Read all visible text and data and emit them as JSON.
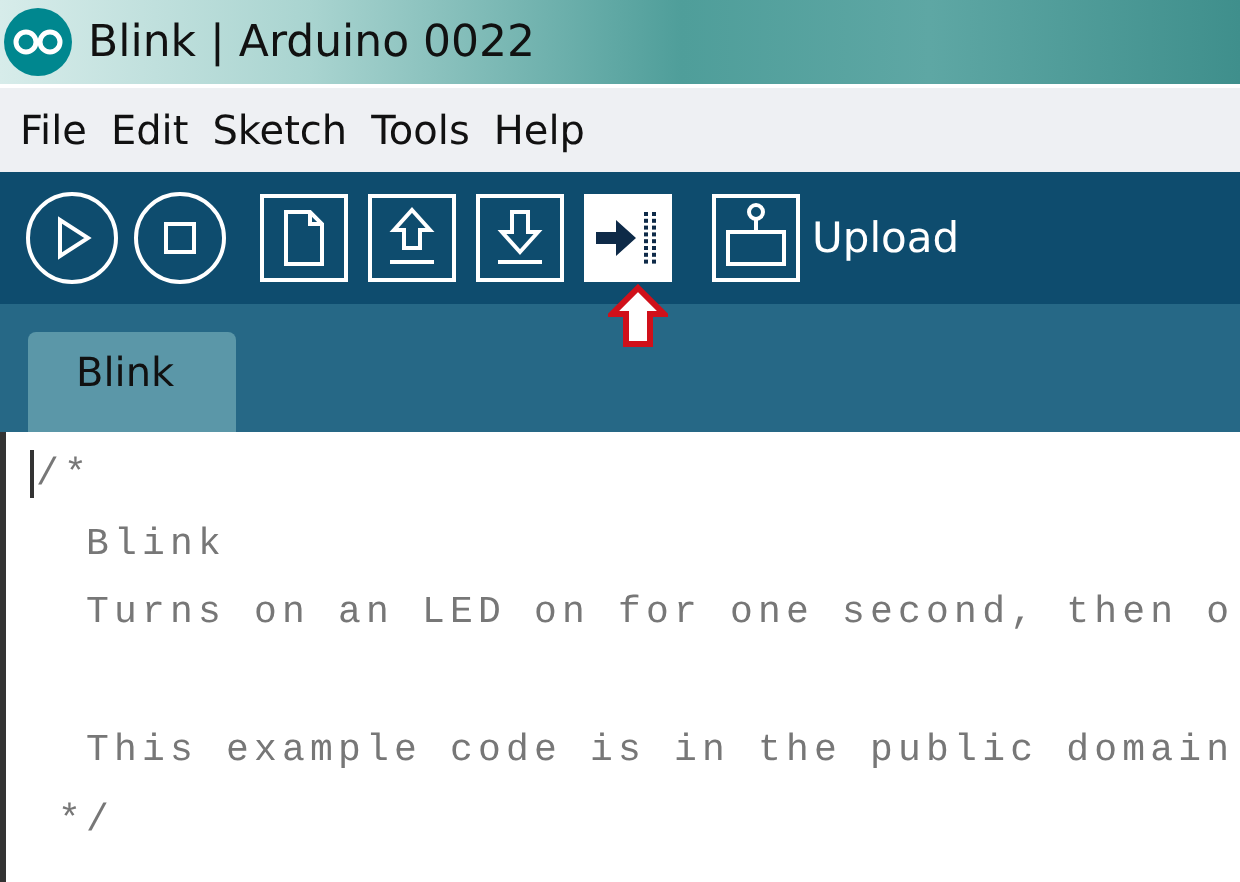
{
  "window": {
    "title": "Blink | Arduino 0022"
  },
  "menu": [
    "File",
    "Edit",
    "Sketch",
    "Tools",
    "Help"
  ],
  "toolbar": [
    {
      "kind": "run",
      "selected": false
    },
    {
      "kind": "stop",
      "selected": false
    },
    {
      "kind": "new",
      "selected": false
    },
    {
      "kind": "open",
      "selected": false
    },
    {
      "kind": "save",
      "selected": false
    },
    {
      "kind": "upload",
      "selected": true
    },
    {
      "kind": "serial",
      "selected": false
    }
  ],
  "toolbar_label": "Upload",
  "tabs": [
    {
      "label": "Blink",
      "selected": true
    }
  ],
  "code_blocks": [
    [
      "/*",
      "  Blink",
      "  Turns on an LED on for one second, then o"
    ],
    [
      "  This example code is in the public domain",
      " */"
    ]
  ]
}
